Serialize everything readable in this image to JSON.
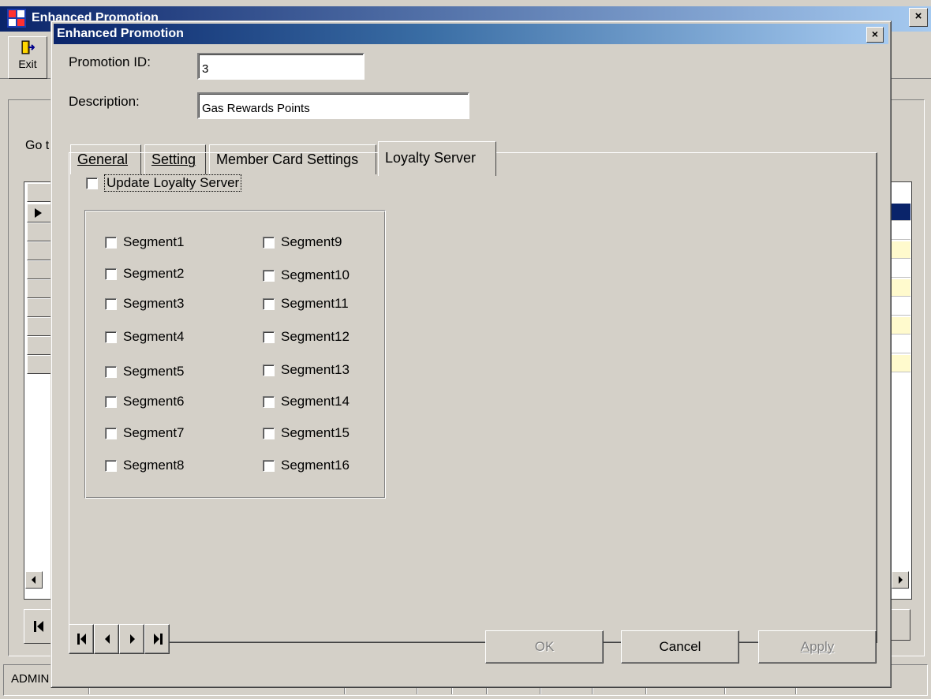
{
  "background_window": {
    "title": "Enhanced Promotion",
    "close_label": "×",
    "toolbar": {
      "exit_label": "Exit"
    },
    "goto_label": "Go t",
    "status_user": "ADMIN"
  },
  "dialog": {
    "title": "Enhanced Promotion",
    "close_label": "×",
    "promotion_id_label": "Promotion ID:",
    "promotion_id_value": "3",
    "description_label": "Description:",
    "description_value": "Gas Rewards Points",
    "tabs": [
      {
        "label": "General",
        "active": false
      },
      {
        "label": "Setting",
        "active": false
      },
      {
        "label": "Member Card Settings",
        "active": false
      },
      {
        "label": "Loyalty Server",
        "active": true
      }
    ],
    "loyalty_server": {
      "update_label": "Update Loyalty Server",
      "segments_left": [
        "Segment1",
        "Segment2",
        "Segment3",
        "Segment4",
        "Segment5",
        "Segment6",
        "Segment7",
        "Segment8"
      ],
      "segments_right": [
        "Segment9",
        "Segment10",
        "Segment11",
        "Segment12",
        "Segment13",
        "Segment14",
        "Segment15",
        "Segment16"
      ]
    },
    "buttons": {
      "ok": "OK",
      "cancel": "Cancel",
      "apply": "Apply"
    },
    "navigation": [
      "first-record-icon",
      "previous-record-icon",
      "next-record-icon",
      "last-record-icon"
    ]
  },
  "colors": {
    "window_face": "#d4d0c8",
    "title_gradient_start": "#0a246a",
    "title_gradient_end": "#a6caf0",
    "grid_alt_row": "#fffacd",
    "grid_selected_row": "#0a246a"
  }
}
